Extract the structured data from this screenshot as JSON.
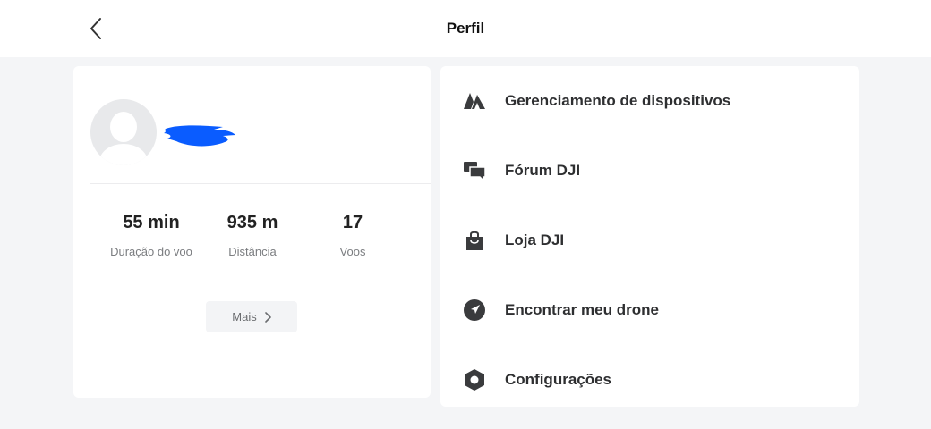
{
  "header": {
    "title": "Perfil",
    "back_icon": "chevron-left-icon"
  },
  "profile": {
    "avatar_icon": "user-placeholder-icon",
    "stats": [
      {
        "value": "55 min",
        "label": "Duração do voo"
      },
      {
        "value": "935 m",
        "label": "Distância"
      },
      {
        "value": "17",
        "label": "Voos"
      }
    ],
    "more_label": "Mais",
    "redaction_color": "#0a5cff"
  },
  "menu": {
    "items": [
      {
        "label": "Gerenciamento de dispositivos",
        "icon": "device-management-icon"
      },
      {
        "label": "Fórum DJI",
        "icon": "forum-icon"
      },
      {
        "label": "Loja DJI",
        "icon": "shopping-bag-icon"
      },
      {
        "label": "Encontrar meu drone",
        "icon": "find-drone-icon"
      },
      {
        "label": "Configurações",
        "icon": "settings-icon"
      }
    ]
  }
}
